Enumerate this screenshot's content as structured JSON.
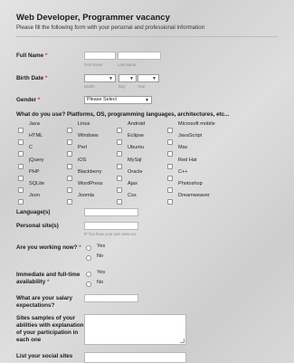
{
  "form": {
    "title": "Web Developer, Programmer vacancy",
    "subtitle": "Please fill the following form with your personal and professional information"
  },
  "full_name": {
    "label": "Full Name",
    "required_mark": "*",
    "first_sub": "First Name",
    "last_sub": "Last Name"
  },
  "birth_date": {
    "label": "Birth Date",
    "required_mark": "*",
    "month_sub": "Month",
    "day_sub": "Day",
    "year_sub": "Year"
  },
  "gender": {
    "label": "Gender",
    "required_mark": "*",
    "selected": "Please Select"
  },
  "platforms": {
    "question": "What do you use? Platforms, OS, programming languages, architectures, etc...",
    "columns": [
      [
        "Java",
        "HTML",
        "C",
        "jQuery",
        "PHP",
        "SQLite",
        "Json"
      ],
      [
        "Linux",
        "Windows",
        "Perl",
        "iOS",
        "Blackberry",
        "WordPress",
        "Joomla"
      ],
      [
        "Android",
        "Eclipse",
        "Ubuntu",
        "MySql",
        "Oracle",
        "Ajax",
        "Css"
      ],
      [
        "Microsoft mobile",
        "JavaScript",
        "Mac",
        "Red Hat",
        "C++",
        "Photoshop",
        "Dreamweaver"
      ]
    ]
  },
  "languages": {
    "label": "Language(s)"
  },
  "personal_sites": {
    "label": "Personal site(s)",
    "hint": "IF You have your own www.xxx"
  },
  "working_now": {
    "label": "Are you working now?",
    "required_mark": "*",
    "options": [
      "Yes",
      "No"
    ]
  },
  "availability": {
    "label_line1": "Immediate and full-time",
    "label_line2": "availability",
    "required_mark": "*",
    "options": [
      "Yes",
      "No"
    ]
  },
  "salary": {
    "label_line1": "What are your salary",
    "label_line2": "expectations?"
  },
  "samples": {
    "label_line1": "Sites samples of your",
    "label_line2": "abilities with explanation",
    "label_line3": "of your participation in",
    "label_line4": "each one"
  },
  "social": {
    "label": "List your social sites"
  }
}
